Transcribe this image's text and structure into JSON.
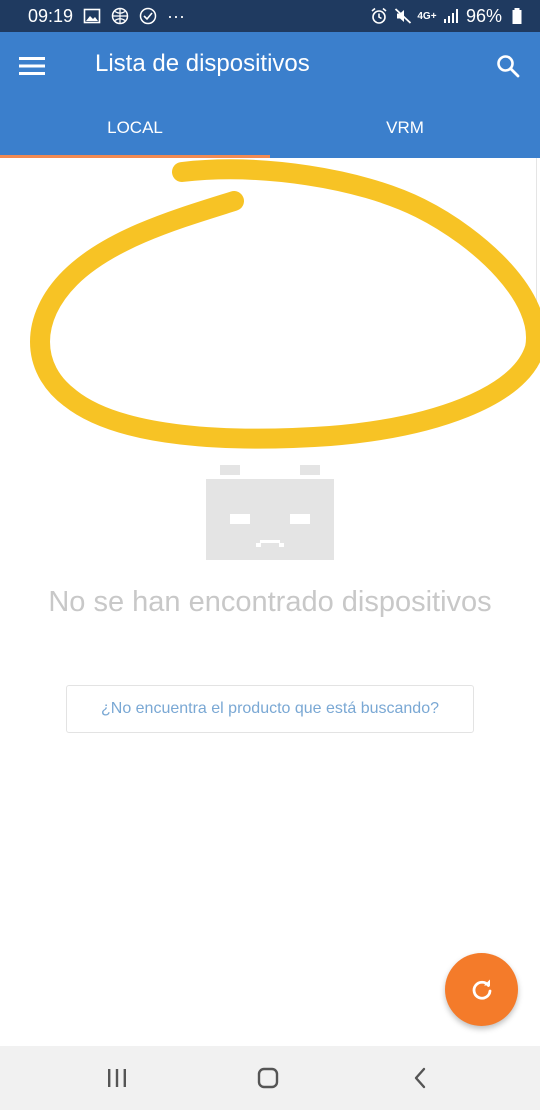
{
  "status_bar": {
    "time": "09:19",
    "more_indicator": "···",
    "network": "4G+",
    "battery": "96%",
    "icons": [
      "image-icon",
      "globe-icon",
      "data-saver-icon",
      "alarm-icon",
      "mute-icon",
      "network-arrows-icon",
      "signal-icon",
      "battery-icon"
    ]
  },
  "app_bar": {
    "title": "Lista de dispositivos",
    "menu_icon": "hamburger-menu-icon",
    "search_icon": "search-icon",
    "background": "#3b7fcc"
  },
  "tabs": [
    {
      "label": "LOCAL",
      "selected": true
    },
    {
      "label": "VRM",
      "selected": false
    }
  ],
  "empty_state": {
    "icon": "sad-robot-icon",
    "message": "No se han encontrado dispositivos",
    "help_link": "¿No encuentra el producto que está buscando?"
  },
  "fab": {
    "icon": "refresh-icon",
    "color": "#f47b2a"
  },
  "nav_bar": {
    "icons": [
      "recent-apps-icon",
      "home-icon",
      "back-icon"
    ]
  },
  "colors": {
    "accent": "#f28a52",
    "annotation": "#f7c325",
    "empty_text": "#c8c8c8",
    "link": "#7aa8d4"
  }
}
